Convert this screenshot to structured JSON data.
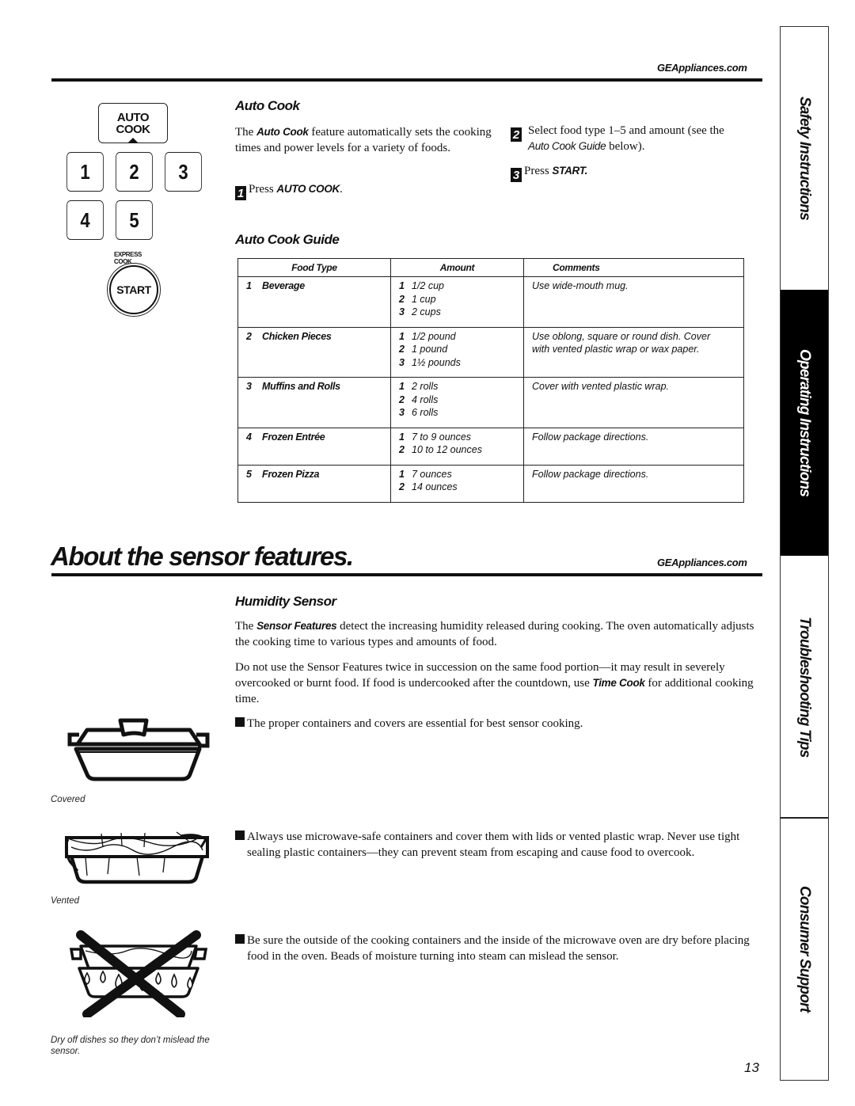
{
  "header": {
    "site_url_top": "GEAppliances.com",
    "site_url_section": "GEAppliances.com"
  },
  "keypad": {
    "auto_cook_key": [
      "AUTO",
      "COOK"
    ],
    "number_keys": [
      "1",
      "2",
      "3",
      "4",
      "5"
    ],
    "express_cook_label": "EXPRESS COOK",
    "start_key": "START"
  },
  "auto_cook": {
    "heading": "Auto Cook",
    "intro_prefix": "The ",
    "intro_em": "Auto Cook",
    "intro_suffix": " feature automatically sets the cooking times and power levels for a variety of foods.",
    "steps": [
      {
        "num": "1",
        "prefix": "Press ",
        "em": "AUTO COOK",
        "suffix": "."
      },
      {
        "num": "2",
        "prefix": "Select food type 1–5 and amount (see the ",
        "em": "Auto Cook Guide",
        "suffix": " below)."
      },
      {
        "num": "3",
        "prefix": "Press ",
        "em": "START.",
        "suffix": ""
      }
    ]
  },
  "guide": {
    "heading": "Auto Cook Guide",
    "columns": [
      "Food Type",
      "Amount",
      "Comments"
    ],
    "rows": [
      {
        "num": "1",
        "food": "Beverage",
        "amounts": [
          [
            "1",
            "1/2 cup"
          ],
          [
            "2",
            "1 cup"
          ],
          [
            "3",
            "2 cups"
          ]
        ],
        "comment": "Use wide-mouth mug."
      },
      {
        "num": "2",
        "food": "Chicken Pieces",
        "amounts": [
          [
            "1",
            "1/2 pound"
          ],
          [
            "2",
            "1 pound"
          ],
          [
            "3",
            "1½ pounds"
          ]
        ],
        "comment": "Use oblong, square or round dish. Cover with vented plastic wrap or wax paper."
      },
      {
        "num": "3",
        "food": "Muffins and Rolls",
        "amounts": [
          [
            "1",
            "2 rolls"
          ],
          [
            "2",
            "4 rolls"
          ],
          [
            "3",
            "6 rolls"
          ]
        ],
        "comment": "Cover with vented plastic wrap."
      },
      {
        "num": "4",
        "food": "Frozen Entrée",
        "amounts": [
          [
            "1",
            "7 to 9 ounces"
          ],
          [
            "2",
            "10 to 12 ounces"
          ]
        ],
        "comment": "Follow package directions."
      },
      {
        "num": "5",
        "food": "Frozen Pizza",
        "amounts": [
          [
            "1",
            "7 ounces"
          ],
          [
            "2",
            "14 ounces"
          ]
        ],
        "comment": "Follow package directions."
      }
    ]
  },
  "sensor": {
    "title": "About the sensor features.",
    "heading": "Humidity Sensor",
    "p1_prefix": "The ",
    "p1_em": "Sensor Features",
    "p1_suffix": " detect the increasing humidity released during cooking. The oven automatically adjusts the cooking time to various types and amounts of food.",
    "p2_prefix": "Do not use the Sensor Features twice in succession on the same food portion—it may result in severely overcooked or burnt food. If food is undercooked after the countdown, use ",
    "p2_em": "Time Cook",
    "p2_suffix": " for additional cooking time.",
    "bullets": [
      "The proper containers and covers are essential for best sensor cooking.",
      "Always use microwave-safe containers and cover them with lids or vented plastic wrap. Never use tight sealing plastic containers—they can prevent steam from escaping and cause food to overcook.",
      "Be sure the outside of the cooking containers and the inside of the microwave oven are dry before placing food in the oven. Beads of moisture turning into steam can mislead the sensor."
    ],
    "captions": {
      "covered": "Covered",
      "vented": "Vented",
      "dry_off": "Dry off dishes so they don’t mislead the sensor."
    }
  },
  "side_tabs": [
    {
      "label": "Safety Instructions",
      "active": false
    },
    {
      "label": "Operating Instructions",
      "active": true
    },
    {
      "label": "Troubleshooting Tips",
      "active": false
    },
    {
      "label": "Consumer Support",
      "active": false
    }
  ],
  "page_number": "13"
}
